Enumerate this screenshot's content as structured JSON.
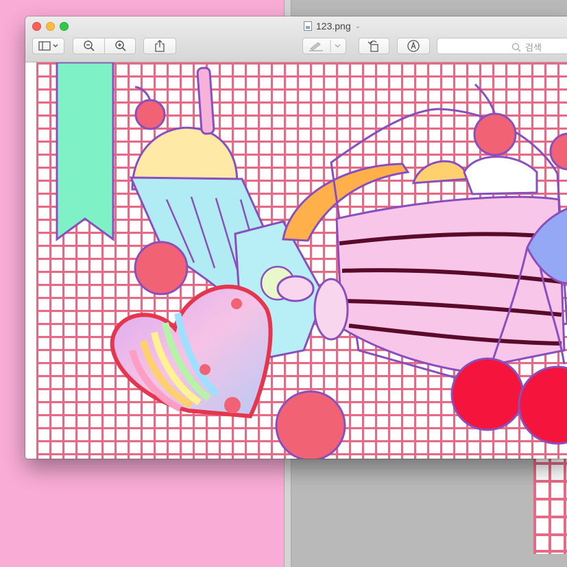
{
  "window": {
    "title": "123.png"
  },
  "toolbar": {
    "sidebar_icon": "sidebar-icon",
    "zoom_out_icon": "zoom-out-icon",
    "zoom_in_icon": "zoom-in-icon",
    "share_icon": "share-icon",
    "markup_pen_icon": "highlighter-icon",
    "rotate_icon": "rotate-icon",
    "markup_icon": "markup-icon"
  },
  "search": {
    "placeholder": "검색"
  },
  "colors": {
    "desktop_pink": "#f9acd6",
    "desktop_gray": "#b9b9b9",
    "grid_line": "#e66a86",
    "outline": "#8a4fbd"
  }
}
